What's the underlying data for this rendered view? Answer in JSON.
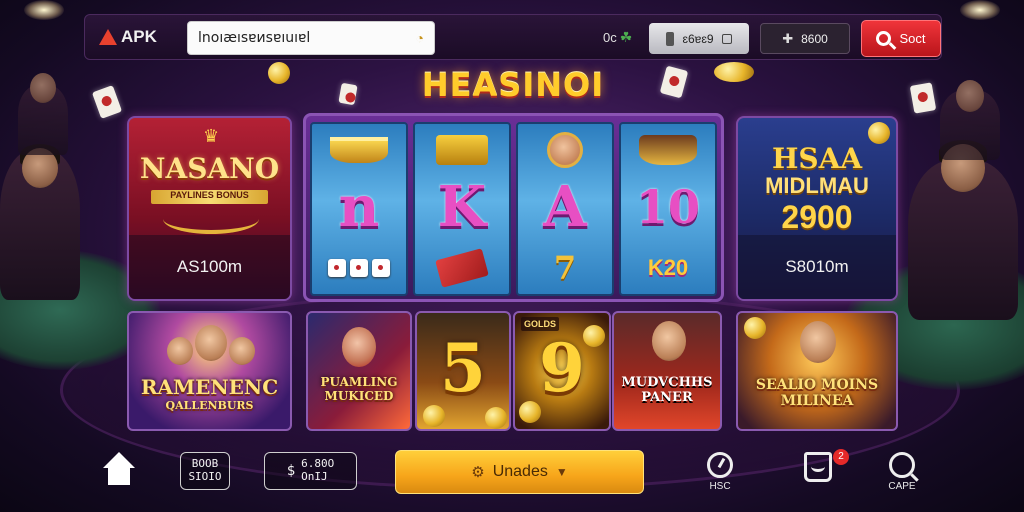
{
  "header": {
    "logo_text": "APK",
    "search_value": "lnoıæısɐиsɐıuıɐl",
    "badge_text": "0c",
    "stat_1_value": "ɛ6ɐɛ9",
    "stat_2_value": "8600",
    "sort_label": "Soct",
    "accent_color": "#e8412e"
  },
  "title": "HEASINOI",
  "promos": {
    "left": {
      "logo": "NASANO",
      "subtitle": "PAYLINES BONUS",
      "amount": "AS100m"
    },
    "right": {
      "name": "HSAA",
      "label": "MIDLMAU",
      "jackpot": "2900",
      "amount": "S8010m"
    }
  },
  "reels": [
    {
      "letter": "n",
      "top_icon": "gold-pot-icon",
      "bottom_icon": "dice-icon"
    },
    {
      "letter": "K",
      "top_icon": "gold-box-icon",
      "bottom_icon": "red-card-icon"
    },
    {
      "letter": "A",
      "top_icon": "face-icon",
      "bottom_icon": "gold-seven",
      "bottom_text": "7"
    },
    {
      "letter": "10",
      "top_icon": "hat-pot-icon",
      "bottom_icon": "k20-text",
      "bottom_text": "K20"
    }
  ],
  "tiles": [
    {
      "label": "RAMENENC",
      "sub": "QALLENBURS"
    },
    {
      "label": "PUAMLING MUKICED"
    },
    {
      "number": "5"
    },
    {
      "number": "9",
      "badge": "GOLDS"
    },
    {
      "label": "MUDVCHHS PANER"
    },
    {
      "label": "SEALIO MOINS MILINEA"
    }
  ],
  "bottom_nav": {
    "box_1_line_1": "BOOB",
    "box_1_line_2": "SIOIO",
    "box_2_icon": "$",
    "box_2_line_1": "6.80O",
    "box_2_line_2": "OnIJ",
    "updates_label": "Unades",
    "nav_hs_label": "HSC",
    "nav_msg_badge": "2",
    "nav_cape_label": "CAPE"
  }
}
